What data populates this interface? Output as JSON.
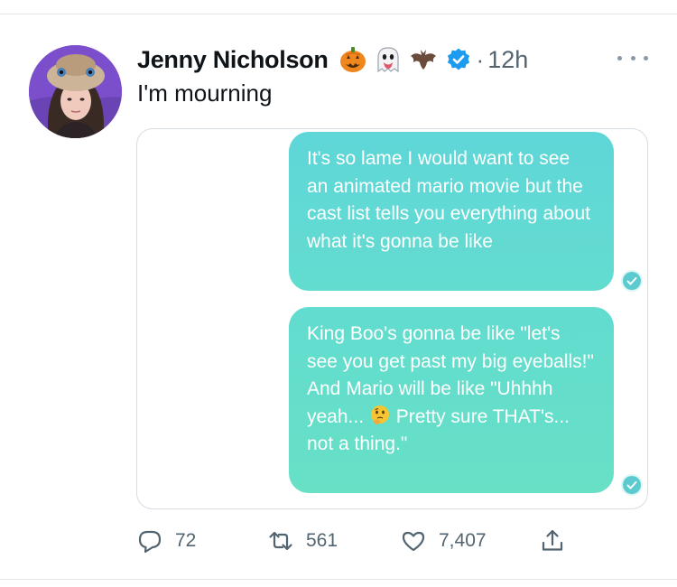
{
  "tweet": {
    "author_name": "Jenny Nicholson",
    "name_emojis": [
      "jack-o-lantern-emoji",
      "ghost-emoji",
      "bat-emoji"
    ],
    "verified": true,
    "separator": "·",
    "time": "12h",
    "text": "I'm mourning"
  },
  "media": {
    "messages": [
      {
        "text": "It's so lame I would want to see an animated mario movie but the cast list tells you everything about what it's gonna be like"
      },
      {
        "text": "King Boo's gonna be like \"let's see you get past my big eyeballs!\" And Mario will be like \"Uhhhh yeah...",
        "emoji": "thinking-face-emoji",
        "text_after": "Pretty sure THAT's... not a thing.\""
      }
    ],
    "bubble_color": "#63dcd0"
  },
  "actions": {
    "replies": "72",
    "retweets": "561",
    "likes": "7,407"
  },
  "colors": {
    "verified": "#1d9bf0",
    "muted": "#536471"
  }
}
